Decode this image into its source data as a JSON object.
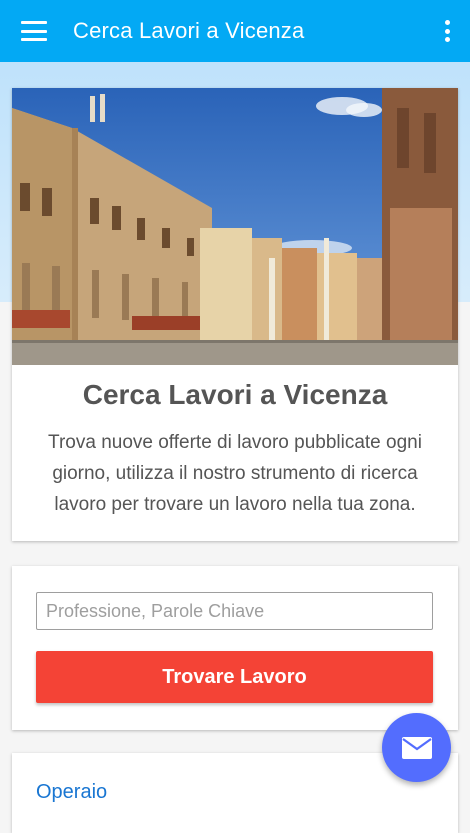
{
  "app_bar": {
    "title": "Cerca Lavori a Vicenza",
    "menu_icon": "hamburger-menu-icon",
    "overflow_icon": "more-vert-icon",
    "color": "#03a9f4"
  },
  "intro": {
    "image": "vicenza-piazza-photo",
    "title": "Cerca Lavori a Vicenza",
    "description": "Trova nuove offerte di lavoro pubblicate ogni giorno, utilizza il nostro strumento di ricerca lavoro per trovare un lavoro nella tua zona."
  },
  "search": {
    "input_placeholder": "Professione, Parole Chiave",
    "input_value": "",
    "button_label": "Trovare Lavoro",
    "button_color": "#f44336"
  },
  "results": {
    "first_item": "Operaio"
  },
  "fab": {
    "icon": "email-icon",
    "color": "#536dfe"
  }
}
